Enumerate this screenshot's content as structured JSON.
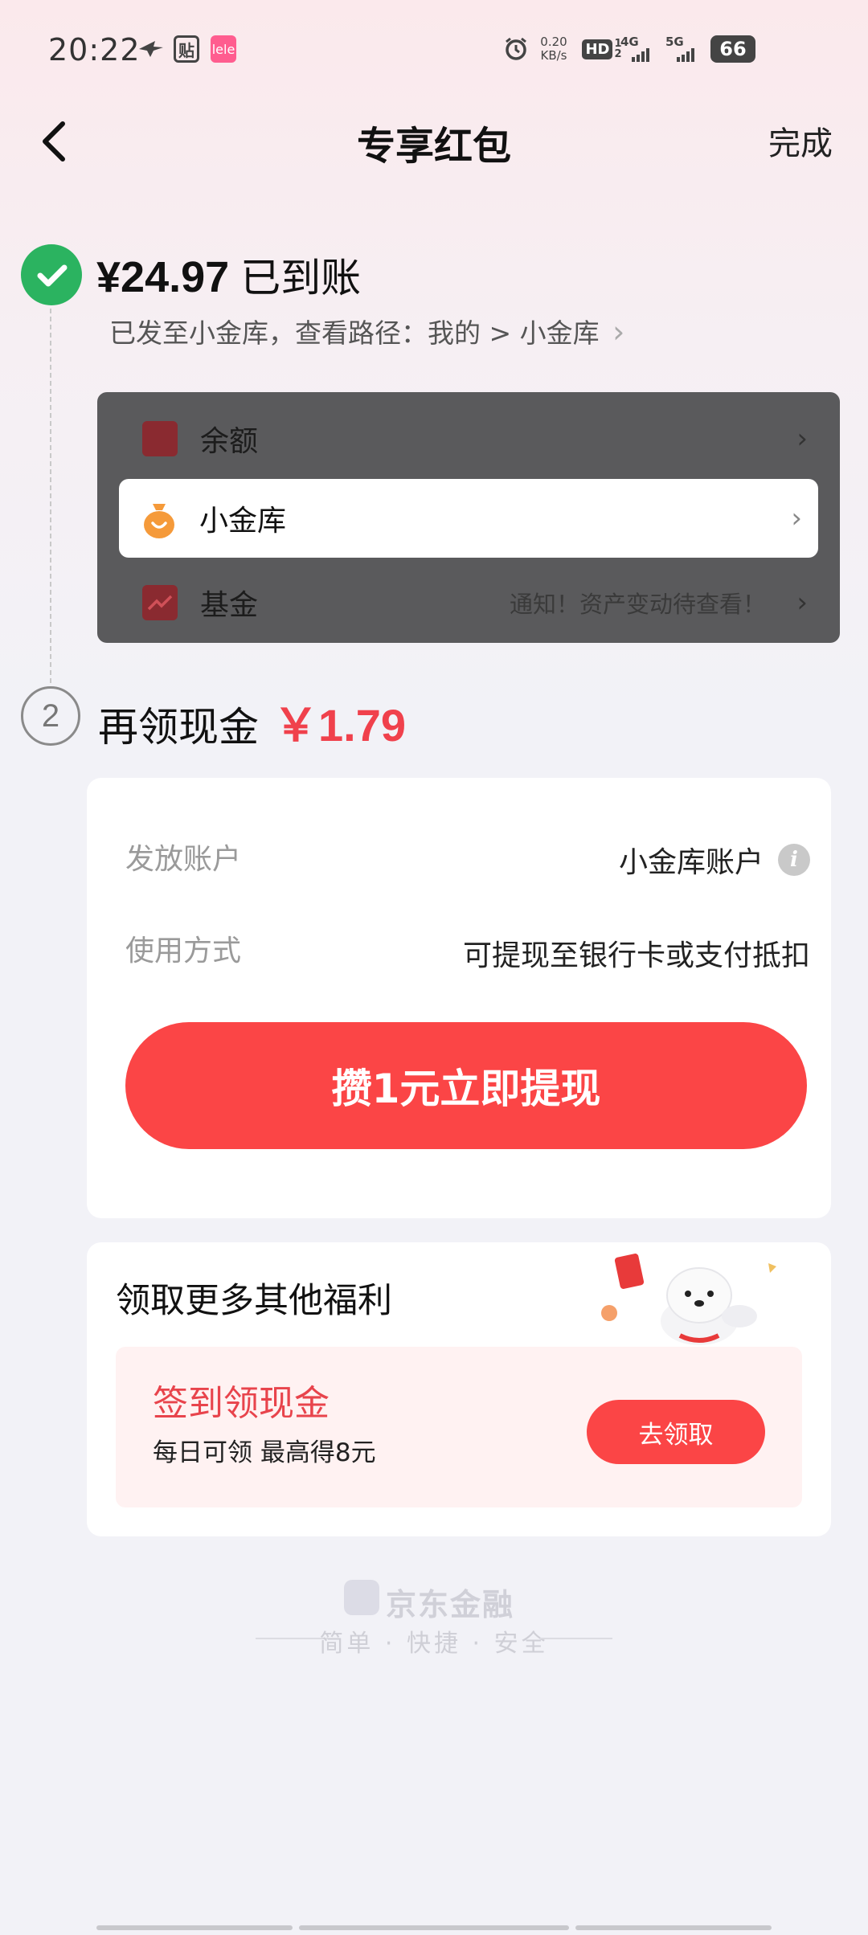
{
  "status_bar": {
    "time": "20:22",
    "icons": [
      "bird-icon",
      "tie-icon",
      "lele-icon",
      "alarm-icon",
      "hd-icon",
      "4g-signal-icon",
      "5g-signal-icon",
      "battery-icon"
    ],
    "tie_label": "贴",
    "lele_label": "lele",
    "net_speed_value": "0.20",
    "net_speed_unit": "KB/s",
    "hd_label": "HD",
    "sim_1": "1",
    "sim_2": "2",
    "net_4g": "4G",
    "net_5g": "5G",
    "battery": "66"
  },
  "header": {
    "title": "专享红包",
    "done_label": "完成"
  },
  "step1": {
    "amount": "¥24.97",
    "status": "已到账",
    "path_text": "已发至小金库，查看路径：我的 > 小金库",
    "path_chevron": "›"
  },
  "menu": {
    "items": [
      {
        "label": "余额",
        "icon": "wallet-icon",
        "color": "#b0262f",
        "note": ""
      },
      {
        "label": "小金库",
        "icon": "moneybag-icon",
        "color": "#f59a3a",
        "note": ""
      },
      {
        "label": "基金",
        "icon": "fund-chart-icon",
        "color": "#b0262f",
        "note": "通知！资产变动待查看！"
      }
    ],
    "chevron": "›"
  },
  "step2": {
    "number": "2",
    "title": "再领现金",
    "amount": "￥1.79",
    "rows": [
      {
        "label": "发放账户",
        "value": "小金库账户"
      },
      {
        "label": "使用方式",
        "value": "可提现至银行卡或支付抵扣"
      }
    ],
    "info_icon_glyph": "i",
    "cash_button": "攒1元立即提现"
  },
  "more": {
    "title": "领取更多其他福利",
    "checkin_title": "签到领现金",
    "checkin_sub": "每日可领 最高得8元",
    "claim_button": "去领取"
  },
  "footer": {
    "brand": "京东金融",
    "slogan": "简单 · 快捷 · 安全"
  },
  "colors": {
    "accent_red": "#fb4546",
    "success_green": "#2bb360",
    "amount_red": "#f0414c"
  }
}
